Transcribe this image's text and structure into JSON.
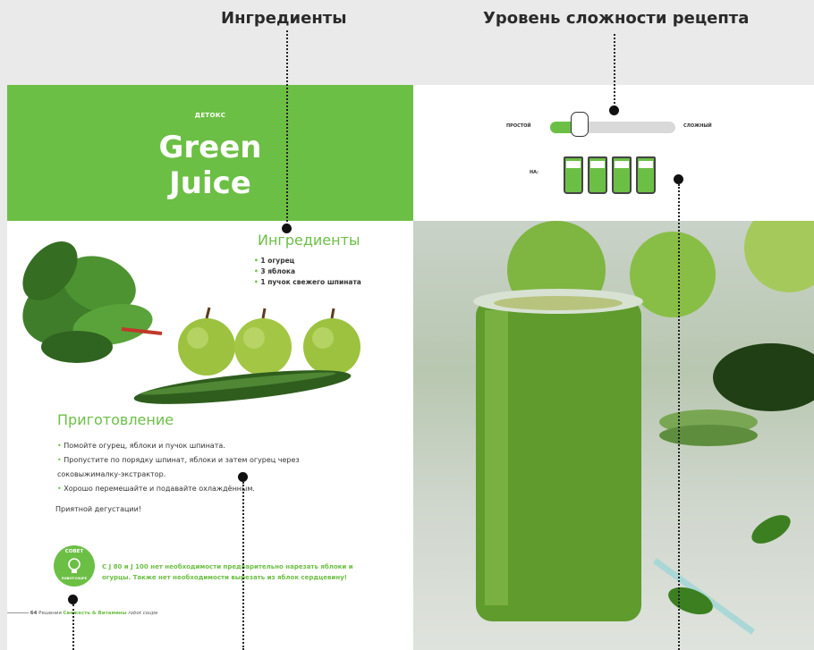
{
  "annotations": {
    "ingredients_label": "Ингредиенты",
    "difficulty_label": "Уровень сложности рецепта"
  },
  "recipe": {
    "category": "ДЕТОКС",
    "title_line1": "Green",
    "title_line2": "Juice",
    "ingredients_heading": "Ингредиенты",
    "ingredients": [
      "1 огурец",
      "3 яблока",
      "1 пучок свежего шпината"
    ],
    "preparation_heading": "Приготовление",
    "steps": [
      "Помойте огурец, яблоки и пучок шпината.",
      "Пропустите по порядку шпинат, яблоки и затем огурец через соковыжималку-экстрактор.",
      "Хорошо перемешайте и подавайте охлаждённым."
    ],
    "enjoy": "Приятной дегустации!",
    "tip_badge_top": "СОВЕТ",
    "tip_badge_bottom": "ROBOT-COUPE",
    "tip": "С J 80 и J 100 нет необходимости предварительно нарезать яблоки и огурцы. Также нет необходимости вырезать из яблок сердцевину!"
  },
  "footer": {
    "page_number": "64",
    "section_prefix": "Решения",
    "section_name": "Свежесть & Витамины",
    "brand": "robot coupe"
  },
  "difficulty": {
    "simple_label": "ПРОСТОЙ",
    "hard_label": "СЛОЖНЫЙ",
    "level_fraction": 0.23
  },
  "serves": {
    "label": "НА:",
    "glasses": 4
  },
  "colors": {
    "accent_green": "#6cbf45",
    "annotation_dark": "#111111"
  },
  "icons": {
    "tip": "lightbulb-icon",
    "difficulty": "hand-icon",
    "serving": "juice-glass-icon"
  }
}
